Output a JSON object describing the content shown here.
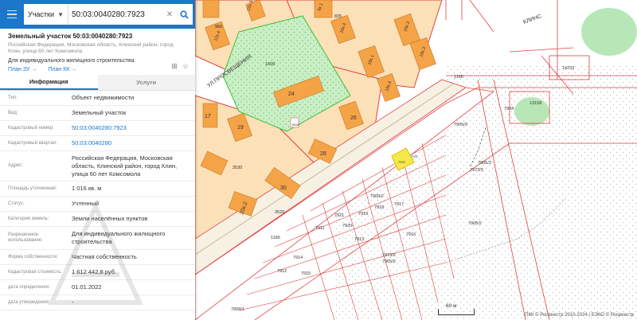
{
  "search": {
    "type": "Участки",
    "query": "50:03:0040280:7923"
  },
  "object": {
    "title": "Земельный участок 50:03:0040280:7923",
    "address": "Российская Федерация, Московская область, Клинский район, город Клин, улица 60 лет Комсомола",
    "usage": "Для индивидуального жилищного строительства",
    "link_zu": "План ЗУ →",
    "link_kk": "План КК →"
  },
  "tabs": [
    "Информация",
    "Услуги"
  ],
  "info_rows": [
    {
      "label": "Тип:",
      "value": "Объект недвижимости"
    },
    {
      "label": "Вид:",
      "value": "Земельный участок"
    },
    {
      "label": "Кадастровый номер:",
      "value": "50:03:0040280:7923"
    },
    {
      "label": "Кадастровый квартал:",
      "value": "50:03:0040280"
    },
    {
      "label": "Адрес:",
      "value": "Российская Федерация, Московская область, Клинский район, город Клин, улица 60 лет Комсомола"
    },
    {
      "label": "Площадь уточненная:",
      "value": "1 016 кв. м"
    },
    {
      "label": "Статус:",
      "value": "Учтенный"
    },
    {
      "label": "Категория земель:",
      "value": "Земли населённых пунктов"
    },
    {
      "label": "Разрешенное использование:",
      "value": "Для индивидуального жилищного строительства"
    },
    {
      "label": "Форма собственности:",
      "value": "Частная собственность"
    },
    {
      "label": "Кадастровая стоимость:",
      "value": "1 612 442,8 руб."
    },
    {
      "label": "дата определения:",
      "value": "01.01.2022"
    },
    {
      "label": "дата утверждения:",
      "value": "-"
    }
  ],
  "map": {
    "street": "УЛ.ПРОСВЕЩЕНИЯ",
    "street2": "КЛИНС",
    "scale": "60 м",
    "copyright": "ПКК © Росреестр 2010-2024 | ЕЭКО © Росреестр",
    "labels": [
      "966",
      "835",
      "12к.3",
      "12к.4",
      "6к.1",
      "16к.3",
      "16к.4",
      "16к.2",
      "18к.3",
      "18к.1",
      "18к.4",
      "1609",
      "24",
      "26",
      "28",
      "17",
      "19",
      "30",
      "20к.2",
      "8542",
      "3530",
      "3529",
      "1166",
      "1166",
      "7904",
      "13158",
      "14233",
      "7909/3",
      "7973/3",
      "7905/3",
      "7905/2",
      "7909/2",
      "7923",
      "7922",
      "7921",
      "7920",
      "7919",
      "7918",
      "7917",
      "7916",
      "7915",
      "7914",
      "7913",
      "7912",
      "7973/2",
      "7905/2",
      "7909/1",
      "7911"
    ]
  },
  "colors": {
    "header": "#1a77c9",
    "building": "#f5a347",
    "parcel_fill": "#fce0b8",
    "green": "#b7e7b7",
    "boundary": "#e04040",
    "highlight": "#f5e84a"
  }
}
